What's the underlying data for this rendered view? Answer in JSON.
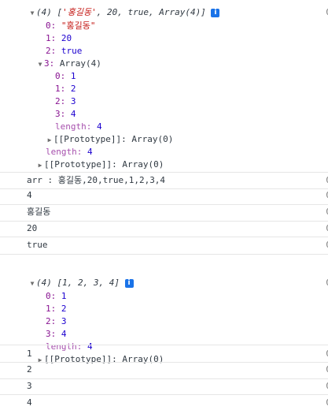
{
  "log1": {
    "summary_prefix": "(4) [",
    "summary_str": "'홍길동'",
    "summary_rest": ", 20, true, Array(4)]",
    "info": "i",
    "items": [
      {
        "key": "0:",
        "value": "\"홍길동\""
      },
      {
        "key": "1:",
        "value": "20"
      },
      {
        "key": "2:",
        "value": "true"
      }
    ],
    "nested": {
      "key": "3:",
      "label": "Array(4)",
      "items": [
        {
          "key": "0:",
          "value": "1"
        },
        {
          "key": "1:",
          "value": "2"
        },
        {
          "key": "2:",
          "value": "3"
        },
        {
          "key": "3:",
          "value": "4"
        }
      ],
      "length_key": "length:",
      "length_value": "4",
      "proto_key": "[[Prototype]]:",
      "proto_value": "Array(0)"
    },
    "length_key": "length:",
    "length_value": "4",
    "proto_key": "[[Prototype]]:",
    "proto_value": "Array(0)"
  },
  "messages": [
    "arr : 홍길동,20,true,1,2,3,4",
    "4",
    "홍길동",
    "20",
    "true"
  ],
  "log2": {
    "summary": "(4) [1, 2, 3, 4]",
    "info": "i",
    "items": [
      {
        "key": "0:",
        "value": "1"
      },
      {
        "key": "1:",
        "value": "2"
      },
      {
        "key": "2:",
        "value": "3"
      },
      {
        "key": "3:",
        "value": "4"
      }
    ],
    "length_key": "length:",
    "length_value": "4",
    "proto_key": "[[Prototype]]:",
    "proto_value": "Array(0)"
  },
  "messages2": [
    "1",
    "2",
    "3",
    "4"
  ],
  "source_stub": "0"
}
